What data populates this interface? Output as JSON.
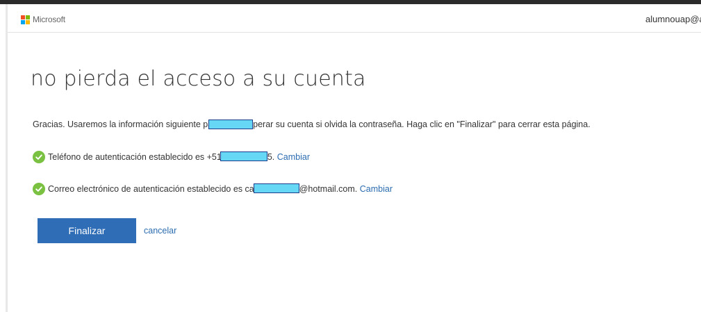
{
  "header": {
    "brand": "Microsoft",
    "user": "alumnouap@a"
  },
  "main": {
    "title": "no pierda el acceso a su cuenta",
    "intro_part1": "Gracias. Usaremos la información siguiente pa",
    "intro_part2": "perar su cuenta si olvida la contraseña. Haga clic en \"Finalizar\" para cerrar esta página.",
    "phone_text_part1": "Teléfono de autenticación establecido es +51",
    "phone_text_part2": "5.",
    "phone_change": "Cambiar",
    "email_text_part1": "Correo electrónico de autenticación establecido es ca",
    "email_text_part2": "@hotmail.com.",
    "email_change": "Cambiar",
    "finalize_button": "Finalizar",
    "cancel_link": "cancelar"
  },
  "icons": {
    "brand_logo": "microsoft-logo-icon",
    "status": "checkmark-circle-icon"
  },
  "colors": {
    "primary_button": "#2f6db6",
    "link": "#2b6cb0",
    "check": "#7ac142",
    "redaction_fill": "#66d8f6"
  }
}
